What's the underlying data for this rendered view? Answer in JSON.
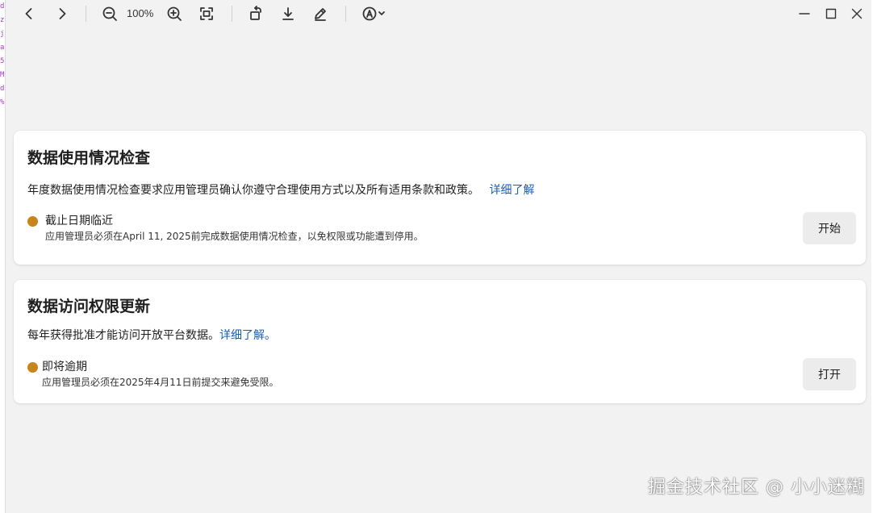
{
  "toolbar": {
    "zoom_level": "100%",
    "icons": [
      "chevron-left-icon",
      "chevron-right-icon",
      "zoom-out-icon",
      "zoom-in-icon",
      "fit-page-icon",
      "rotate-icon",
      "download-icon",
      "draw-icon",
      "read-aloud-icon",
      "minimize-icon",
      "maximize-icon",
      "close-icon"
    ]
  },
  "cards": [
    {
      "title": "数据使用情况检查",
      "description": "年度数据使用情况检查要求应用管理员确认你遵守合理使用方式以及所有适用条款和政策。",
      "link": "详细了解",
      "status_title": "截止日期临近",
      "status_detail": "应用管理员必须在April 11, 2025前完成数据使用情况检查，以免权限或功能遭到停用。",
      "button": "开始"
    },
    {
      "title": "数据访问权限更新",
      "description": "每年获得批准才能访问开放平台数据。",
      "link": "详细了解。",
      "status_title": "即将逾期",
      "status_detail": "应用管理员必须在2025年4月11日前提交来避免受限。",
      "button": "打开"
    }
  ],
  "colors": {
    "status_dot": "#c8861a",
    "link": "#1a5fb4"
  },
  "watermark": "掘金技术社区 @ 小小迷糊"
}
